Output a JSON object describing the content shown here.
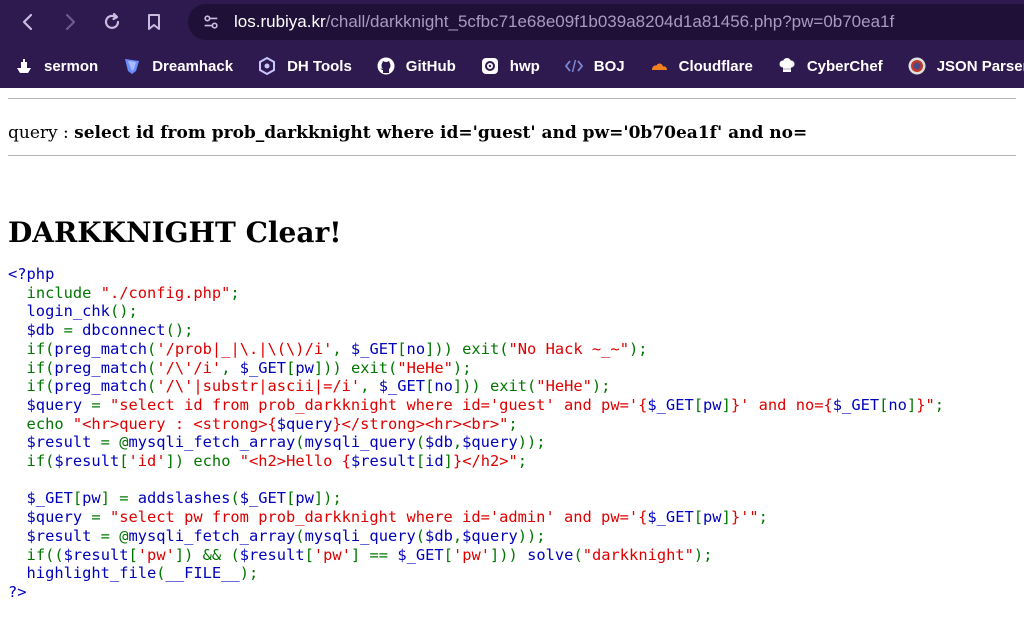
{
  "browser": {
    "url_host": "los.rubiya.kr",
    "url_path": "/chall/darkknight_5cfbc71e68e09f1b039a8204d1a81456.php?pw=0b70ea1f",
    "bookmarks": [
      {
        "label": "sermon",
        "icon": "ship-icon"
      },
      {
        "label": "Dreamhack",
        "icon": "dreamhack-shield-icon"
      },
      {
        "label": "DH Tools",
        "icon": "hexagon-icon"
      },
      {
        "label": "GitHub",
        "icon": "github-icon"
      },
      {
        "label": "hwp",
        "icon": "hwp-icon"
      },
      {
        "label": "BOJ",
        "icon": "code-brackets-icon"
      },
      {
        "label": "Cloudflare",
        "icon": "cloud-icon"
      },
      {
        "label": "CyberChef",
        "icon": "chef-icon"
      },
      {
        "label": "JSON Parser",
        "icon": "json-icon"
      }
    ]
  },
  "page": {
    "query_label": "query : ",
    "query_value": "select id from prob_darkknight where id='guest' and pw='0b70ea1f' and no=",
    "heading": "DARKKNIGHT Clear!"
  },
  "code_lines": [
    [
      [
        "v",
        "<?php"
      ]
    ],
    [
      [
        "v",
        "  "
      ],
      [
        "k",
        "include "
      ],
      [
        "s",
        "\"./config.php\""
      ],
      [
        "k",
        ";"
      ]
    ],
    [
      [
        "v",
        "  login_chk"
      ],
      [
        "k",
        "();"
      ]
    ],
    [
      [
        "v",
        "  $db "
      ],
      [
        "k",
        "= "
      ],
      [
        "v",
        "dbconnect"
      ],
      [
        "k",
        "();"
      ]
    ],
    [
      [
        "v",
        "  "
      ],
      [
        "k",
        "if("
      ],
      [
        "v",
        "preg_match"
      ],
      [
        "k",
        "("
      ],
      [
        "s",
        "'/prob|_|\\.|\\(\\)/i'"
      ],
      [
        "k",
        ", "
      ],
      [
        "v",
        "$_GET"
      ],
      [
        "k",
        "["
      ],
      [
        "v",
        "no"
      ],
      [
        "k",
        "])) exit("
      ],
      [
        "s",
        "\"No Hack ~_~\""
      ],
      [
        "k",
        ");"
      ]
    ],
    [
      [
        "v",
        "  "
      ],
      [
        "k",
        "if("
      ],
      [
        "v",
        "preg_match"
      ],
      [
        "k",
        "("
      ],
      [
        "s",
        "'/\\'/i'"
      ],
      [
        "k",
        ", "
      ],
      [
        "v",
        "$_GET"
      ],
      [
        "k",
        "["
      ],
      [
        "v",
        "pw"
      ],
      [
        "k",
        "])) exit("
      ],
      [
        "s",
        "\"HeHe\""
      ],
      [
        "k",
        ");"
      ]
    ],
    [
      [
        "v",
        "  "
      ],
      [
        "k",
        "if("
      ],
      [
        "v",
        "preg_match"
      ],
      [
        "k",
        "("
      ],
      [
        "s",
        "'/\\'|substr|ascii|=/i'"
      ],
      [
        "k",
        ", "
      ],
      [
        "v",
        "$_GET"
      ],
      [
        "k",
        "["
      ],
      [
        "v",
        "no"
      ],
      [
        "k",
        "])) exit("
      ],
      [
        "s",
        "\"HeHe\""
      ],
      [
        "k",
        ");"
      ]
    ],
    [
      [
        "v",
        "  $query "
      ],
      [
        "k",
        "= "
      ],
      [
        "s",
        "\"select id from prob_darkknight where id='guest' and pw='{"
      ],
      [
        "v",
        "$_GET"
      ],
      [
        "k",
        "["
      ],
      [
        "v",
        "pw"
      ],
      [
        "k",
        "]"
      ],
      [
        "s",
        "}' and no={"
      ],
      [
        "v",
        "$_GET"
      ],
      [
        "k",
        "["
      ],
      [
        "v",
        "no"
      ],
      [
        "k",
        "]"
      ],
      [
        "s",
        "}\""
      ],
      [
        "k",
        ";"
      ]
    ],
    [
      [
        "v",
        "  "
      ],
      [
        "k",
        "echo "
      ],
      [
        "s",
        "\"<hr>query : <strong>{"
      ],
      [
        "v",
        "$query"
      ],
      [
        "s",
        "}</strong><hr><br>\""
      ],
      [
        "k",
        ";"
      ]
    ],
    [
      [
        "v",
        "  $result "
      ],
      [
        "k",
        "= @"
      ],
      [
        "v",
        "mysqli_fetch_array"
      ],
      [
        "k",
        "("
      ],
      [
        "v",
        "mysqli_query"
      ],
      [
        "k",
        "("
      ],
      [
        "v",
        "$db"
      ],
      [
        "k",
        ","
      ],
      [
        "v",
        "$query"
      ],
      [
        "k",
        "));"
      ]
    ],
    [
      [
        "v",
        "  "
      ],
      [
        "k",
        "if("
      ],
      [
        "v",
        "$result"
      ],
      [
        "k",
        "["
      ],
      [
        "s",
        "'id'"
      ],
      [
        "k",
        "]) echo "
      ],
      [
        "s",
        "\"<h2>Hello {"
      ],
      [
        "v",
        "$result"
      ],
      [
        "k",
        "["
      ],
      [
        "v",
        "id"
      ],
      [
        "k",
        "]"
      ],
      [
        "s",
        "}</h2>\""
      ],
      [
        "k",
        ";"
      ]
    ],
    [
      [
        "v",
        ""
      ]
    ],
    [
      [
        "v",
        "  $_GET"
      ],
      [
        "k",
        "["
      ],
      [
        "v",
        "pw"
      ],
      [
        "k",
        "] = "
      ],
      [
        "v",
        "addslashes"
      ],
      [
        "k",
        "("
      ],
      [
        "v",
        "$_GET"
      ],
      [
        "k",
        "["
      ],
      [
        "v",
        "pw"
      ],
      [
        "k",
        "]);"
      ]
    ],
    [
      [
        "v",
        "  $query "
      ],
      [
        "k",
        "= "
      ],
      [
        "s",
        "\"select pw from prob_darkknight where id='admin' and pw='{"
      ],
      [
        "v",
        "$_GET"
      ],
      [
        "k",
        "["
      ],
      [
        "v",
        "pw"
      ],
      [
        "k",
        "]"
      ],
      [
        "s",
        "}'\""
      ],
      [
        "k",
        ";"
      ]
    ],
    [
      [
        "v",
        "  $result "
      ],
      [
        "k",
        "= @"
      ],
      [
        "v",
        "mysqli_fetch_array"
      ],
      [
        "k",
        "("
      ],
      [
        "v",
        "mysqli_query"
      ],
      [
        "k",
        "("
      ],
      [
        "v",
        "$db"
      ],
      [
        "k",
        ","
      ],
      [
        "v",
        "$query"
      ],
      [
        "k",
        "));"
      ]
    ],
    [
      [
        "v",
        "  "
      ],
      [
        "k",
        "if(("
      ],
      [
        "v",
        "$result"
      ],
      [
        "k",
        "["
      ],
      [
        "s",
        "'pw'"
      ],
      [
        "k",
        "]) && ("
      ],
      [
        "v",
        "$result"
      ],
      [
        "k",
        "["
      ],
      [
        "s",
        "'pw'"
      ],
      [
        "k",
        "] == "
      ],
      [
        "v",
        "$_GET"
      ],
      [
        "k",
        "["
      ],
      [
        "s",
        "'pw'"
      ],
      [
        "k",
        "])) "
      ],
      [
        "v",
        "solve"
      ],
      [
        "k",
        "("
      ],
      [
        "s",
        "\"darkknight\""
      ],
      [
        "k",
        ");"
      ]
    ],
    [
      [
        "v",
        "  highlight_file"
      ],
      [
        "k",
        "("
      ],
      [
        "v",
        "__FILE__"
      ],
      [
        "k",
        ");"
      ]
    ],
    [
      [
        "v",
        "?>"
      ]
    ]
  ],
  "colors": {
    "chrome_bg": "#2f1a4f",
    "php_default": "#0000bb",
    "php_keyword": "#007700",
    "php_string": "#dd0000"
  }
}
